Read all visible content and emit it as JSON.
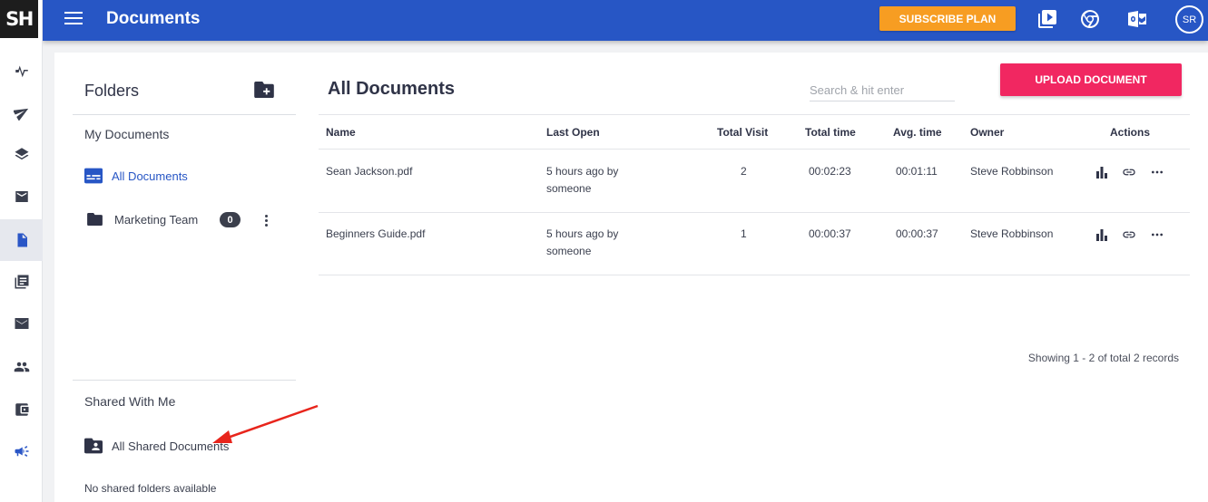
{
  "app": {
    "logo_text": "SH"
  },
  "topbar": {
    "title": "Documents",
    "subscribe_label": "SUBSCRIBE PLAN",
    "avatar_initials": "SR",
    "icons": [
      "youtube-icon",
      "chrome-icon",
      "outlook-icon"
    ]
  },
  "rail": {
    "items": [
      "activity-icon",
      "send-icon",
      "layers-icon",
      "mail-icon",
      "document-icon",
      "library-icon",
      "email-icon",
      "people-icon",
      "wallet-icon",
      "megaphone-icon"
    ],
    "active": "document-icon"
  },
  "folders": {
    "title": "Folders",
    "my_documents_title": "My Documents",
    "all_documents_label": "All Documents",
    "items": [
      {
        "label": "Marketing Team",
        "count": "0"
      }
    ],
    "shared_title": "Shared With Me",
    "all_shared_label": "All Shared Documents",
    "no_shared_text": "No shared folders available"
  },
  "main": {
    "title": "All Documents",
    "search_placeholder": "Search & hit enter",
    "upload_label": "UPLOAD DOCUMENT",
    "columns": [
      "Name",
      "Last Open",
      "Total Visit",
      "Total time",
      "Avg. time",
      "Owner",
      "Actions"
    ],
    "rows": [
      {
        "name": "Sean Jackson.pdf",
        "last_open_1": "5 hours ago by",
        "last_open_2": "someone",
        "visits": "2",
        "total_time": "00:02:23",
        "avg_time": "00:01:11",
        "owner": "Steve Robbinson"
      },
      {
        "name": "Beginners Guide.pdf",
        "last_open_1": "5 hours ago by",
        "last_open_2": "someone",
        "visits": "1",
        "total_time": "00:00:37",
        "avg_time": "00:00:37",
        "owner": "Steve Robbinson"
      }
    ],
    "records_text": "Showing 1 - 2 of total 2 records"
  },
  "colors": {
    "primary": "#2756c5",
    "subscribe": "#f79d22",
    "upload": "#f12761",
    "annotation_arrow": "#e8251c"
  }
}
